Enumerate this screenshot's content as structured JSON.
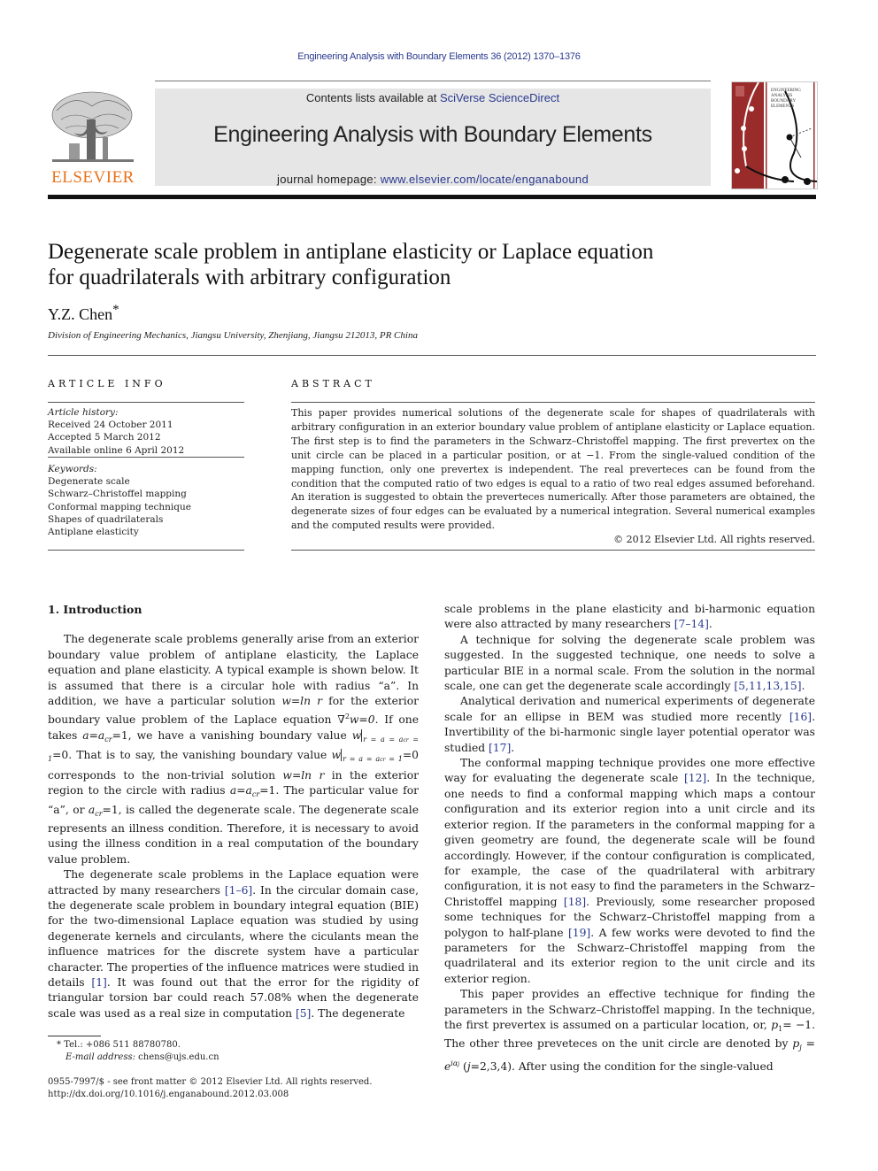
{
  "running_head": "Engineering Analysis with Boundary Elements 36 (2012) 1370–1376",
  "masthead": {
    "contents_prefix": "Contents lists available at ",
    "contents_link": "SciVerse ScienceDirect",
    "journal_title": "Engineering Analysis with Boundary Elements",
    "homepage_prefix": "journal homepage: ",
    "homepage_link": "www.elsevier.com/locate/enganabound",
    "publisher_logo": "ELSEVIER",
    "cover_title": "ENGINEERING ANALYSIS with BOUNDARY ELEMENTS",
    "colors": {
      "link": "#2a3a8f",
      "elsevier_orange": "#e8721c",
      "cover_red": "#9a2b2b"
    }
  },
  "article": {
    "title_line1": "Degenerate scale problem in antiplane elasticity or Laplace equation",
    "title_line2": "for quadrilaterals with arbitrary configuration",
    "author": "Y.Z. Chen",
    "author_mark": "*",
    "affiliation": "Division of Engineering Mechanics, Jiangsu University, Zhenjiang, Jiangsu 212013, PR China"
  },
  "article_info": {
    "heading": "ARTICLE INFO",
    "history_label": "Article history:",
    "history": [
      "Received 24 October 2011",
      "Accepted 5 March 2012",
      "Available online 6 April 2012"
    ],
    "keywords_label": "Keywords:",
    "keywords": [
      "Degenerate scale",
      "Schwarz–Christoffel mapping",
      "Conformal mapping technique",
      "Shapes of quadrilaterals",
      "Antiplane elasticity"
    ]
  },
  "abstract": {
    "heading": "ABSTRACT",
    "text": "This paper provides numerical solutions of the degenerate scale for shapes of quadrilaterals with arbitrary configuration in an exterior boundary value problem of antiplane elasticity or Laplace equation. The first step is to find the parameters in the Schwarz–Christoffel mapping. The first prevertex on the unit circle can be placed in a particular position, or at −1. From the single-valued condition of the mapping function, only one prevertex is independent. The real preverteces can be found from the condition that the computed ratio of two edges is equal to a ratio of two real edges assumed beforehand. An iteration is suggested to obtain the preverteces numerically. After those parameters are obtained, the degenerate sizes of four edges can be evaluated by a numerical integration. Several numerical examples and the computed results were provided.",
    "copyright": "© 2012 Elsevier Ltd. All rights reserved."
  },
  "intro": {
    "heading": "1.  Introduction",
    "p1": {
      "a": "The degenerate scale problems generally arise from an exterior boundary value problem of antiplane elasticity, the Laplace equation and plane elasticity. A typical example is shown below. It is assumed that there is a circular hole with radius “a”. In addition, we have a particular solution ",
      "eq1": "w=ln r",
      "b": " for the exterior boundary value problem of the Laplace equation ∇",
      "sup2": "2",
      "eq2": "w=0",
      "c": ". If one takes ",
      "eq3": "a=a",
      "cr": "cr",
      "eq3b": "=1",
      "d": ", we have a vanishing boundary value ",
      "w": "w",
      "bar_sub": "r = a = a",
      "bar_sub_cr": "cr",
      "bar_sub_end": " = 1",
      "e": "=0. That is to say, the vanishing boundary value ",
      "f": "=0 corresponds to the non-trivial solution ",
      "g": " in the exterior region to the circle with radius ",
      "h": ". The particular value for “a”, or ",
      "eq4": "a",
      "i": "=1, is called the degenerate scale. The degenerate scale represents an illness condition. Therefore, it is necessary to avoid using the illness condition in a real computation of the boundary value problem."
    },
    "p2": {
      "a": "The degenerate scale problems in the Laplace equation were attracted by many researchers ",
      "ref1": "[1–6]",
      "b": ". In the circular domain case, the degenerate scale problem in boundary integral equation (BIE) for the two-dimensional Laplace equation was studied by using degenerate kernels and circulants, where the ciculants mean the influence matrices for the discrete system have a particular character. The properties of the influence matrices were studied in details ",
      "ref2": "[1]",
      "c": ". It was found out that the error for the rigidity of triangular torsion bar could reach 57.08% when the degenerate scale was used as a real size in computation ",
      "ref3": "[5]",
      "d": ". The degenerate"
    },
    "p2_cont": {
      "a": "scale problems in the plane elasticity and bi-harmonic equation were also attracted by many researchers ",
      "ref": "[7–14]",
      "b": "."
    },
    "p3": {
      "a": "A technique for solving the degenerate scale problem was suggested. In the suggested technique, one needs to solve a particular BIE in a normal scale. From the solution in the normal scale, one can get the degenerate scale accordingly ",
      "ref": "[5,11,13,15]",
      "b": "."
    },
    "p4": {
      "a": "Analytical derivation and numerical experiments of degenerate scale for an ellipse in BEM was studied more recently ",
      "ref1": "[16]",
      "b": ". Invertibility of the bi-harmonic single layer potential operator was studied ",
      "ref2": "[17]",
      "c": "."
    },
    "p5": {
      "a": "The conformal mapping technique provides one more effective way for evaluating the degenerate scale ",
      "ref1": "[12]",
      "b": ". In the technique, one needs to find a conformal mapping which maps a contour configuration and its exterior region into a unit circle and its exterior region. If the parameters in the conformal mapping for a given geometry are found, the degenerate scale will be found accordingly. However, if the contour configuration is complicated, for example, the case of the quadrilateral with arbitrary configuration, it is not easy to find the parameters in the Schwarz–Christoffel mapping ",
      "ref2": "[18]",
      "c": ". Previously, some researcher proposed some techniques for the Schwarz–Christoffel mapping from a polygon to half-plane ",
      "ref3": "[19]",
      "d": ". A few works were devoted to find the parameters for the Schwarz–Christoffel mapping from the quadrilateral and its exterior region to the unit circle and its exterior region."
    },
    "p6": {
      "a": "This paper provides an effective technique for finding the parameters in the Schwarz–Christoffel mapping. In the technique, the first prevertex is assumed on a particular location, or, ",
      "p1": "p",
      "p1_sub": "1",
      "p1_val": "= −1",
      "b": ". The other three preveteces on the unit circle are denoted by ",
      "pj": "p",
      "pj_sub": "j",
      "pj_eq": " = e",
      "pj_sup": "iα",
      "pj_sup_sub": "j",
      "c": " (",
      "j": "j",
      "d": "=2,3,4). After using the condition for the single-valued"
    }
  },
  "footnotes": {
    "tel": "* Tel.: +086 511 88780780.",
    "email_label": "E-mail address:",
    "email": " chens@ujs.edu.cn",
    "front_matter": "0955-7997/$ - see front matter © 2012 Elsevier Ltd. All rights reserved.",
    "doi": "http://dx.doi.org/10.1016/j.enganabound.2012.03.008"
  }
}
